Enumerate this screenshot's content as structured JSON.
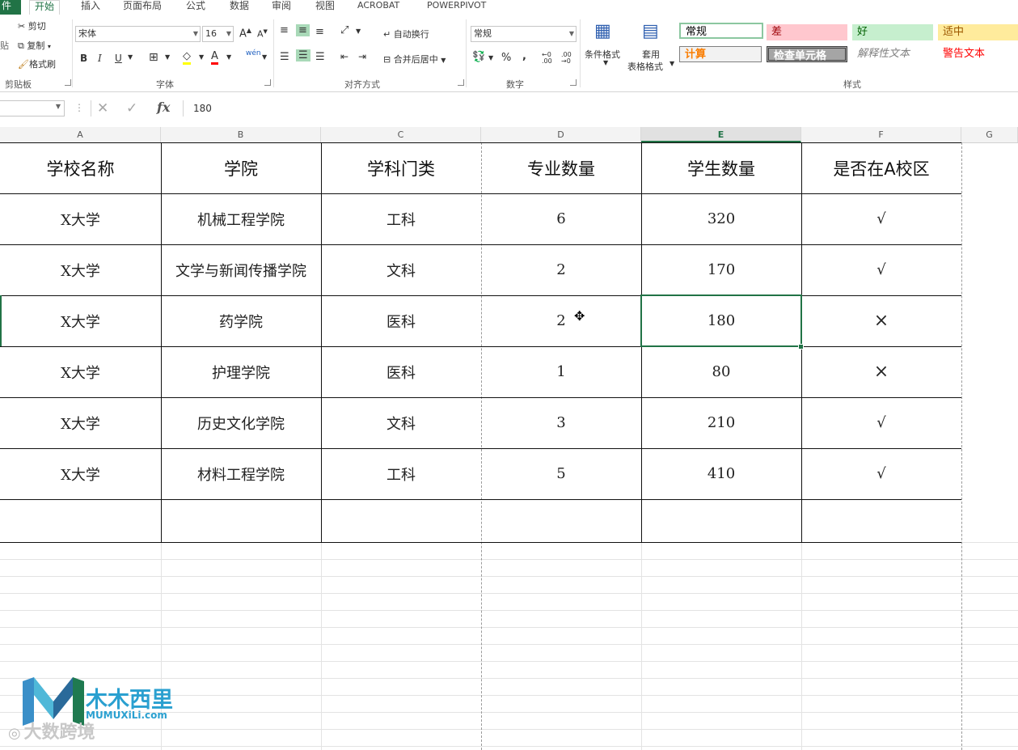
{
  "tabs": [
    "件",
    "开始",
    "插入",
    "页面布局",
    "公式",
    "数据",
    "审阅",
    "视图",
    "ACROBAT",
    "POWERPIVOT"
  ],
  "clipboard": {
    "cut": "剪切",
    "copy": "复制",
    "format_painter": "格式刷",
    "paste_partial": "贴",
    "group": "剪贴板"
  },
  "font": {
    "name": "宋体",
    "size": "16",
    "bold": "B",
    "italic": "I",
    "underline": "U",
    "grow": "A",
    "shrink": "A",
    "color_a": "A",
    "pinyin": "wén",
    "group": "字体"
  },
  "alignment": {
    "wrap": "自动换行",
    "merge": "合并后居中",
    "group": "对齐方式"
  },
  "number": {
    "format": "常规",
    "percent": "%",
    "comma": ",",
    "inc": "←0 .00",
    "dec": ".00 →0",
    "group": "数字"
  },
  "styles": {
    "conditional": "条件格式",
    "table1": "套用",
    "table2": "表格格式",
    "cells": [
      {
        "label": "常规",
        "bg": "#ffffff",
        "color": "#000000",
        "border": "#8cc7a0"
      },
      {
        "label": "差",
        "bg": "#ffc7ce",
        "color": "#9c0006",
        "border": "#ffc7ce"
      },
      {
        "label": "好",
        "bg": "#c6efce",
        "color": "#006100",
        "border": "#c6efce"
      },
      {
        "label": "适中",
        "bg": "#ffeb9c",
        "color": "#9c5700",
        "border": "#ffeb9c"
      },
      {
        "label": "计算",
        "bg": "#f2f2f2",
        "color": "#fa7d00",
        "border": "#7f7f7f"
      },
      {
        "label": "检查单元格",
        "bg": "#a5a5a5",
        "color": "#ffffff",
        "border": "#3f3f3f"
      },
      {
        "label": "解释性文本",
        "bg": "#ffffff",
        "color": "#7f7f7f",
        "border": "#ffffff"
      },
      {
        "label": "警告文本",
        "bg": "#ffffff",
        "color": "#ff0000",
        "border": "#ffffff"
      }
    ],
    "group": "样式"
  },
  "formula_bar": {
    "cancel": "✕",
    "enter": "✓",
    "fx": "fx",
    "value": "180"
  },
  "columns": [
    "A",
    "B",
    "C",
    "D",
    "E",
    "F",
    "G"
  ],
  "table": {
    "headers": [
      "学校名称",
      "学院",
      "学科门类",
      "专业数量",
      "学生数量",
      "是否在A校区"
    ],
    "rows": [
      [
        "X大学",
        "机械工程学院",
        "工科",
        "6",
        "320",
        "√"
      ],
      [
        "X大学",
        "文学与新闻传播学院",
        "文科",
        "2",
        "170",
        "√"
      ],
      [
        "X大学",
        "药学院",
        "医科",
        "2",
        "180",
        "×"
      ],
      [
        "X大学",
        "护理学院",
        "医科",
        "1",
        "80",
        "×"
      ],
      [
        "X大学",
        "历史文化学院",
        "文科",
        "3",
        "210",
        "√"
      ],
      [
        "X大学",
        "材料工程学院",
        "工科",
        "5",
        "410",
        "√"
      ]
    ]
  },
  "watermark": {
    "brand": "木木西里",
    "url": "MUMUXiLi.com",
    "logo_letter": "M",
    "source": "大数跨境"
  },
  "colors": {
    "accent": "#217346",
    "border": "#111111"
  }
}
